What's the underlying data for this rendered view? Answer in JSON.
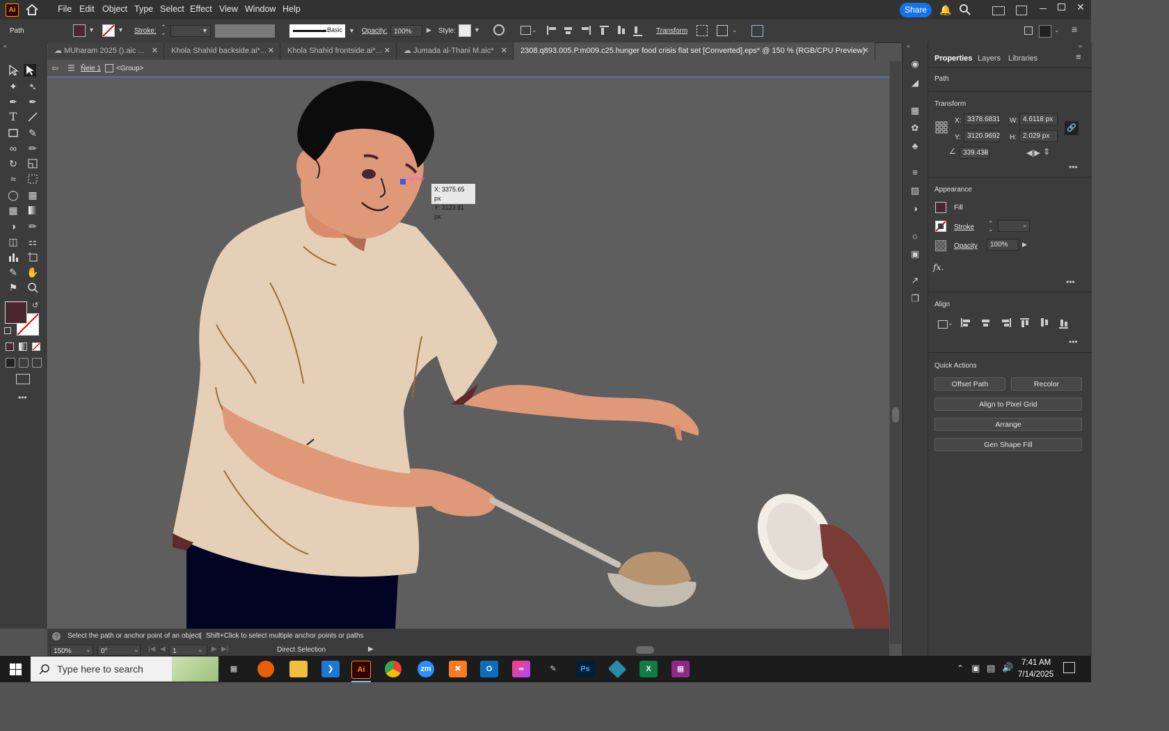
{
  "app": {
    "logo": "Ai",
    "menus": [
      "File",
      "Edit",
      "Object",
      "Type",
      "Select",
      "Effect",
      "View",
      "Window",
      "Help"
    ],
    "share_label": "Share"
  },
  "control_bar": {
    "object_type": "Path",
    "stroke_label": "Stroke:",
    "stroke_profile": "Basic",
    "opacity_label": "Opacity:",
    "opacity_value": "100%",
    "style_label": "Style:",
    "transform_label": "Transform",
    "fill_color": "#4a2630"
  },
  "tabs": [
    {
      "label": "MUharam 2025 ().aic ..."
    },
    {
      "label": "Khola Shahid backside.ai*..."
    },
    {
      "label": "Khola Shahid frontside.ai*..."
    },
    {
      "label": "Jumada al-Thani M.aic*"
    },
    {
      "label": "2308.q893.005.P.m009.c25.hunger food crisis flat set [Converted].eps* @ 150 % (RGB/CPU Preview)"
    }
  ],
  "breadcrumb": {
    "layer": "Ñeie 1",
    "group": "<Group>"
  },
  "canvas": {
    "tooltip_x": "X: 3375.65 px",
    "tooltip_y": "Y: 3123.81 px",
    "smart_guide": "center"
  },
  "properties": {
    "tabs": [
      "Properties",
      "Layers",
      "Libraries"
    ],
    "object_type": "Path",
    "transform_title": "Transform",
    "x_label": "X:",
    "x_value": "3378.6831",
    "y_label": "Y:",
    "y_value": "3120.9692",
    "w_label": "W:",
    "w_value": "4.6118 px",
    "h_label": "H:",
    "h_value": "2.029 px",
    "angle_value": "339.438",
    "appearance_title": "Appearance",
    "fill_label": "Fill",
    "stroke_label": "Stroke",
    "opacity_label": "Opacity",
    "opacity_value": "100%",
    "fx_label": "fx.",
    "align_title": "Align",
    "quick_actions_title": "Quick Actions",
    "offset_path": "Offset Path",
    "recolor": "Recolor",
    "align_pixel": "Align to Pixel Grid",
    "arrange": "Arrange",
    "gen_shape_fill": "Gen Shape Fill"
  },
  "status": {
    "hint_part1": "Select the path or anchor point of an object",
    "hint_sep": "|",
    "hint_part2": "Shift+Click to select multiple anchor points or paths",
    "zoom": "150%",
    "rotation": "0°",
    "artboard": "1",
    "tool": "Direct Selection"
  },
  "taskbar": {
    "search_placeholder": "Type here to search",
    "time": "7:41 AM",
    "date": "7/14/2025",
    "apps": [
      "Firefox",
      "File Explorer",
      "VS Code",
      "Illustrator",
      "Chrome",
      "Zoom",
      "XAMPP",
      "Outlook",
      "Creative Cloud",
      "Pen",
      "Photoshop",
      "App",
      "Excel",
      "WinRAR"
    ]
  }
}
